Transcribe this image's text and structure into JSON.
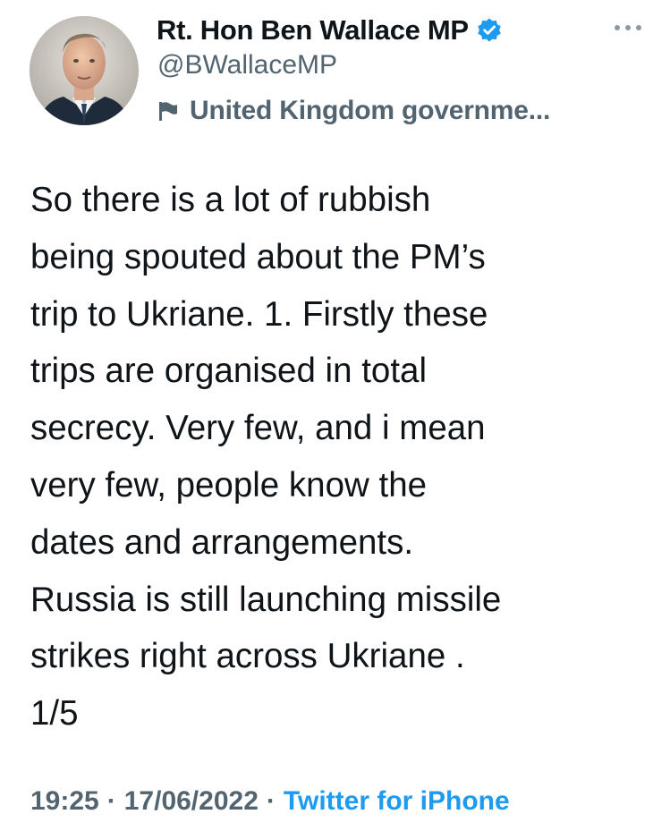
{
  "author": {
    "display_name": "Rt. Hon Ben Wallace MP",
    "handle": "@BWallaceMP",
    "verified": true,
    "label": "United Kingdom governme..."
  },
  "icons": {
    "verified": "verified-badge-icon",
    "more": "more-options-icon",
    "flag": "government-flag-icon"
  },
  "tweet": {
    "lines": [
      "So there is a lot of rubbish",
      "being spouted about the PM’s",
      "trip to Ukriane. 1. Firstly these",
      "trips are organised in total",
      "secrecy. Very few, and i mean",
      "very few, people know the",
      "dates and arrangements.",
      "Russia is still launching missile",
      "strikes right across Ukriane .",
      "1/5"
    ]
  },
  "meta": {
    "time": "19:25",
    "separator": "·",
    "date": "17/06/2022",
    "source": "Twitter for iPhone"
  },
  "colors": {
    "text_primary": "#0f1419",
    "text_secondary": "#536471",
    "accent": "#1d9bf0"
  }
}
